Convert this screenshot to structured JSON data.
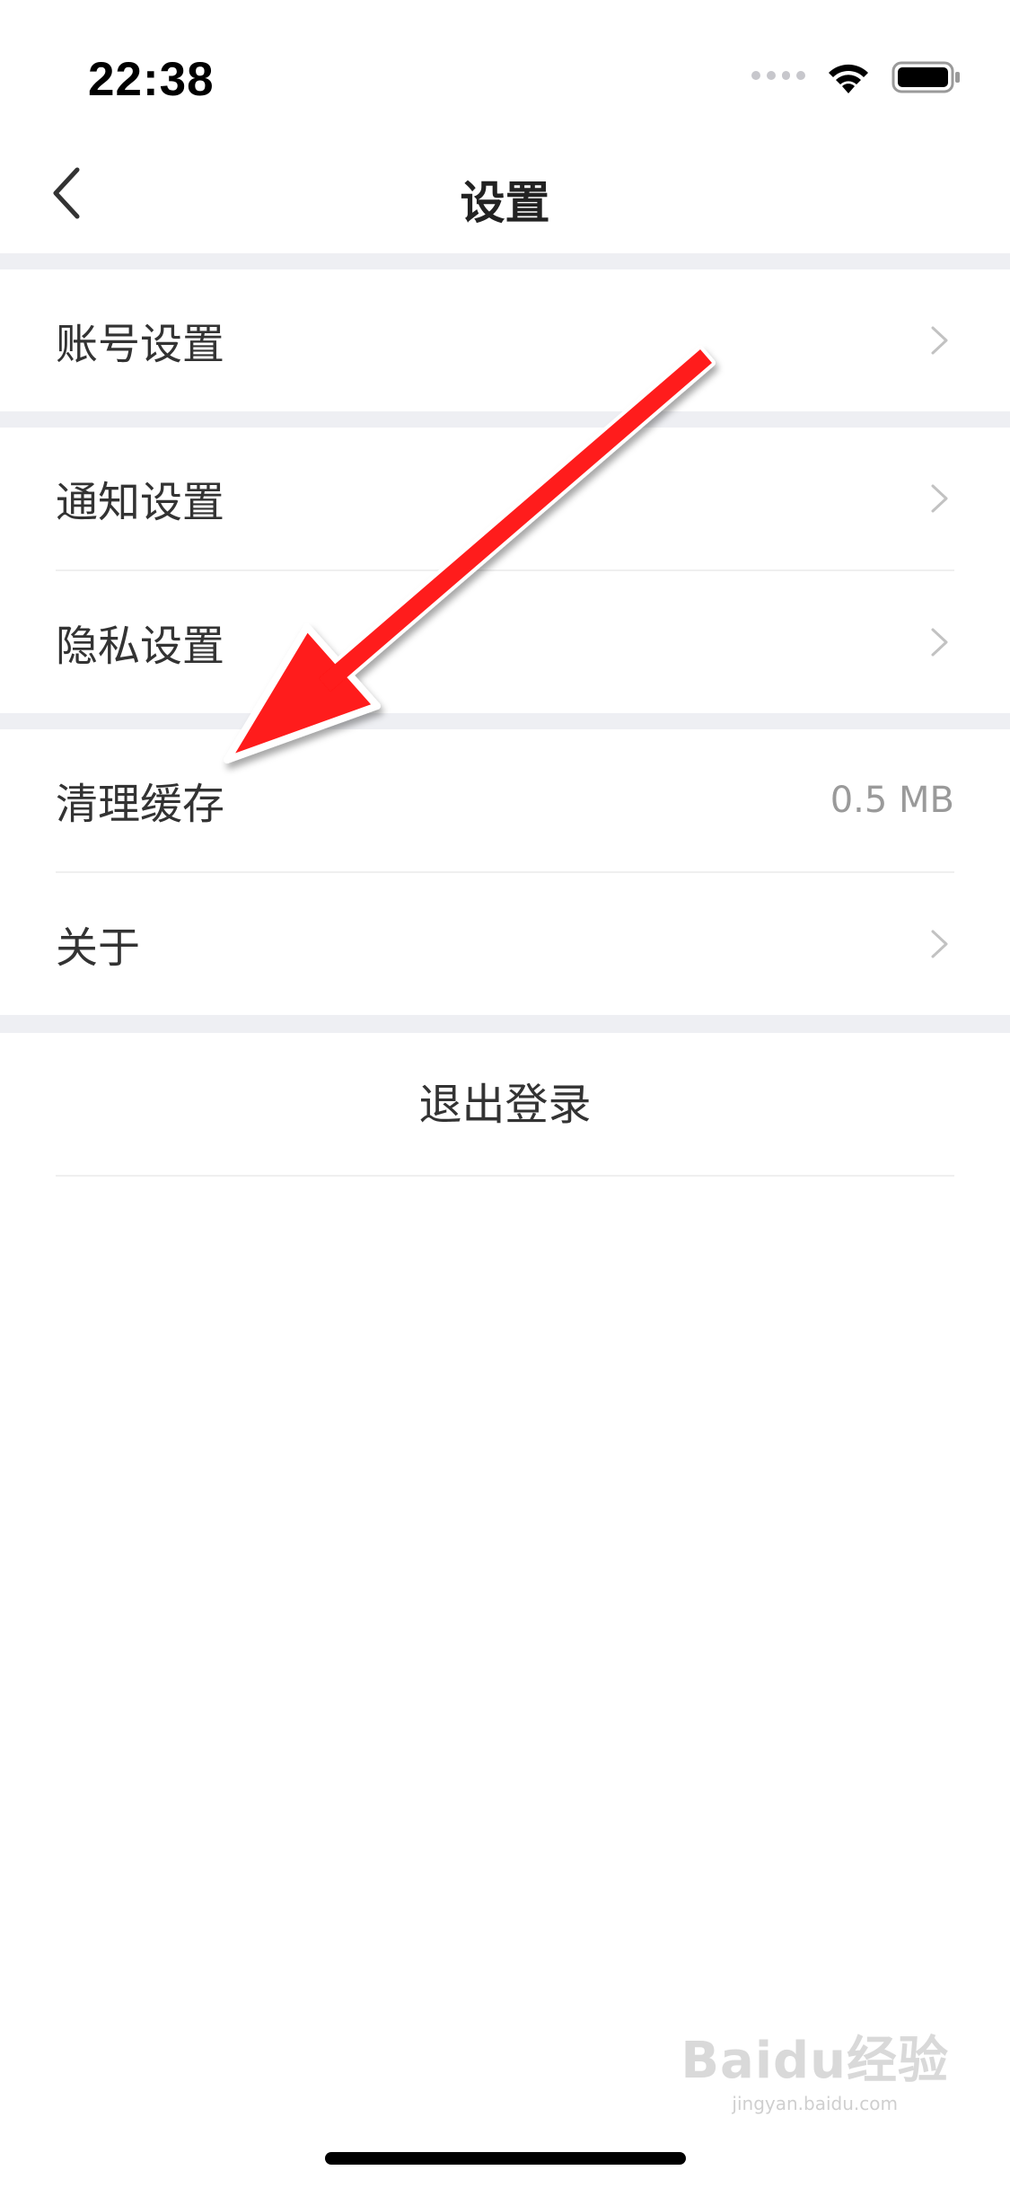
{
  "status_bar": {
    "time": "22:38"
  },
  "nav": {
    "title": "设置"
  },
  "settings": {
    "account": {
      "label": "账号设置"
    },
    "notifications": {
      "label": "通知设置"
    },
    "privacy": {
      "label": "隐私设置"
    },
    "clear_cache": {
      "label": "清理缓存",
      "value": "0.5 MB"
    },
    "about": {
      "label": "关于"
    }
  },
  "logout": {
    "label": "退出登录"
  },
  "watermark": {
    "logo": "Baidu经验",
    "sub": "jingyan.baidu.com"
  },
  "colors": {
    "arrow": "#ff1a1a",
    "separator": "#eeeff3",
    "value_text": "#9a9a9a"
  },
  "icons": {
    "back": "chevron-left-icon",
    "row_arrow": "chevron-right-icon",
    "status": [
      "signal-icon",
      "wifi-icon",
      "battery-icon"
    ]
  }
}
